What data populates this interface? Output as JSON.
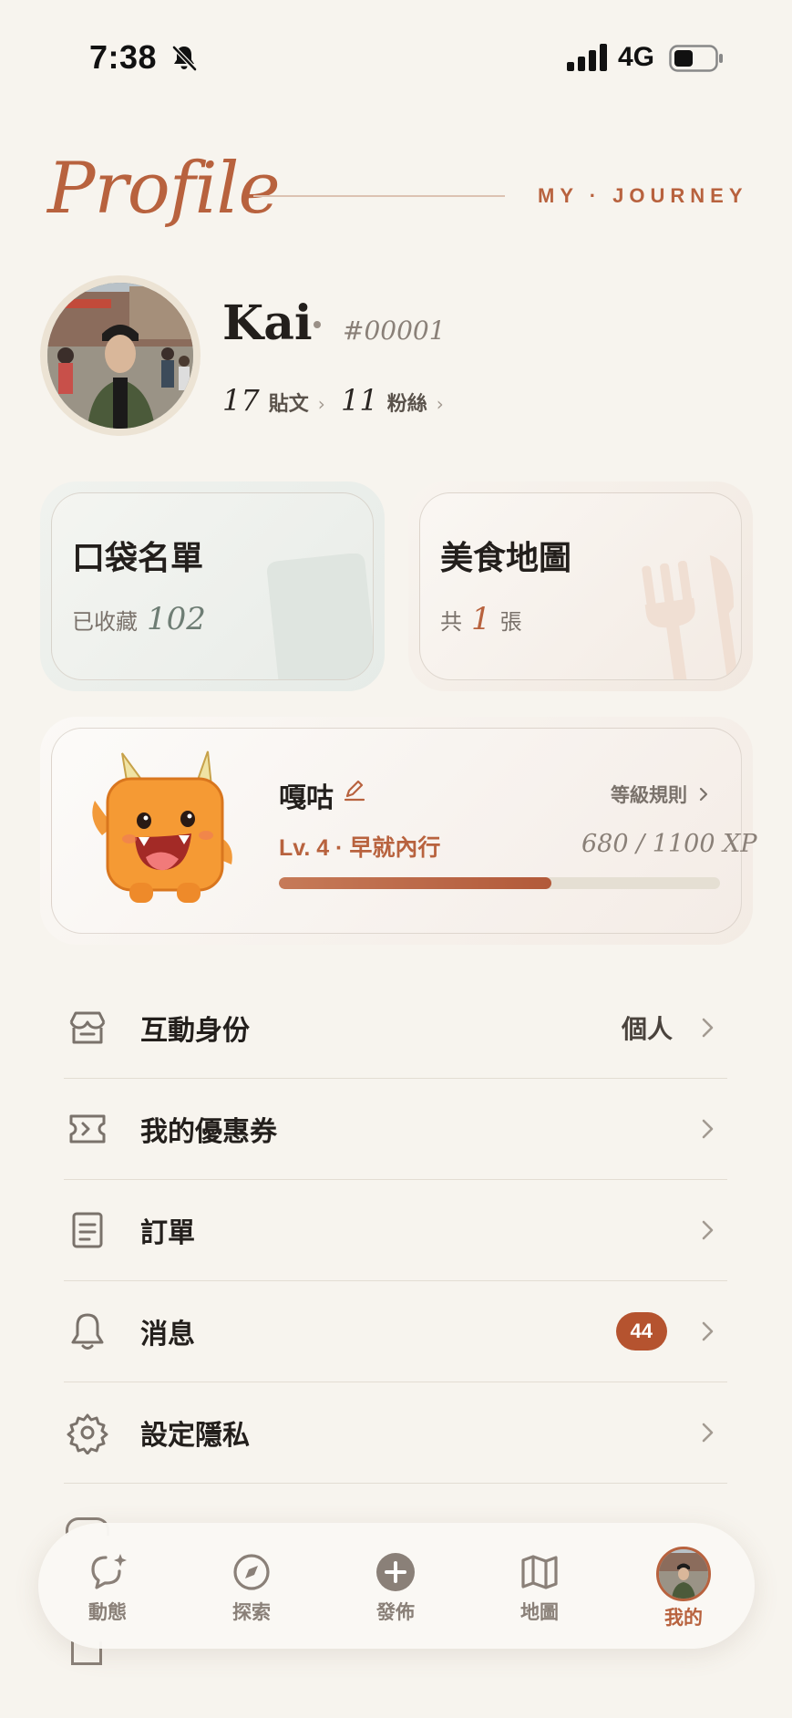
{
  "status_bar": {
    "time": "7:38",
    "network": "4G"
  },
  "header": {
    "title": "Profile",
    "tagline": "MY · JOURNEY"
  },
  "profile": {
    "name": "Kai",
    "user_id": "#00001",
    "posts": {
      "count": "17",
      "label": "貼文"
    },
    "followers": {
      "count": "11",
      "label": "粉絲"
    }
  },
  "cards": {
    "pocket_list": {
      "title": "口袋名單",
      "prefix": "已收藏",
      "count": "102"
    },
    "food_map": {
      "title": "美食地圖",
      "prefix": "共",
      "count": "1",
      "suffix": "張"
    }
  },
  "level": {
    "pet_name": "嘎咕",
    "rules_label": "等級規則",
    "level_label": "Lv. 4 · 早就內行",
    "xp_text": "680 / 1100 XP",
    "xp_current": 680,
    "xp_total": 1100
  },
  "menu": [
    {
      "label": "互動身份",
      "value": "個人",
      "icon": "storefront-icon"
    },
    {
      "label": "我的優惠券",
      "icon": "ticket-icon"
    },
    {
      "label": "訂單",
      "icon": "document-icon"
    },
    {
      "label": "消息",
      "badge": "44",
      "icon": "bell-icon"
    },
    {
      "label": "設定隱私",
      "icon": "gear-icon"
    }
  ],
  "tabbar": [
    {
      "label": "動態",
      "icon": "chat-sparkle-icon"
    },
    {
      "label": "探索",
      "icon": "compass-icon"
    },
    {
      "label": "發佈",
      "icon": "plus-circle-icon"
    },
    {
      "label": "地圖",
      "icon": "map-icon"
    },
    {
      "label": "我的",
      "icon": "avatar",
      "active": true
    }
  ],
  "colors": {
    "accent": "#b8623e",
    "background": "#f7f4ee",
    "badge": "#b5532f"
  }
}
